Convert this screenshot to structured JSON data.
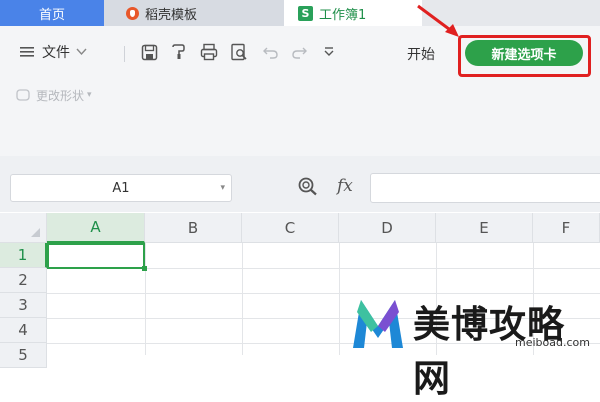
{
  "tabs": {
    "home": "首页",
    "templates": "稻壳模板",
    "workbook": "工作簿1",
    "workbook_icon_letter": "S"
  },
  "toolbar": {
    "file_menu": "文件",
    "start_tab": "开始",
    "new_tab_button": "新建选项卡",
    "shape_button": "更改形状",
    "icons": [
      "menu-icon",
      "chevron-down-icon",
      "save-icon",
      "format-painter-icon",
      "print-icon",
      "print-preview-icon",
      "undo-icon",
      "redo-icon",
      "customize-icon"
    ]
  },
  "formula_bar": {
    "cell_ref": "A1",
    "fx_label": "fx",
    "formula": ""
  },
  "grid": {
    "columns": [
      "A",
      "B",
      "C",
      "D",
      "E",
      "F"
    ],
    "rows": [
      "1",
      "2",
      "3",
      "4",
      "5"
    ],
    "active_cell": "A1"
  },
  "watermark": {
    "text": "美博攻略网",
    "url": "meiboad.com"
  },
  "colors": {
    "accent_green": "#2da14a",
    "home_tab_blue": "#4a83e8",
    "highlight_red": "#e02020"
  }
}
